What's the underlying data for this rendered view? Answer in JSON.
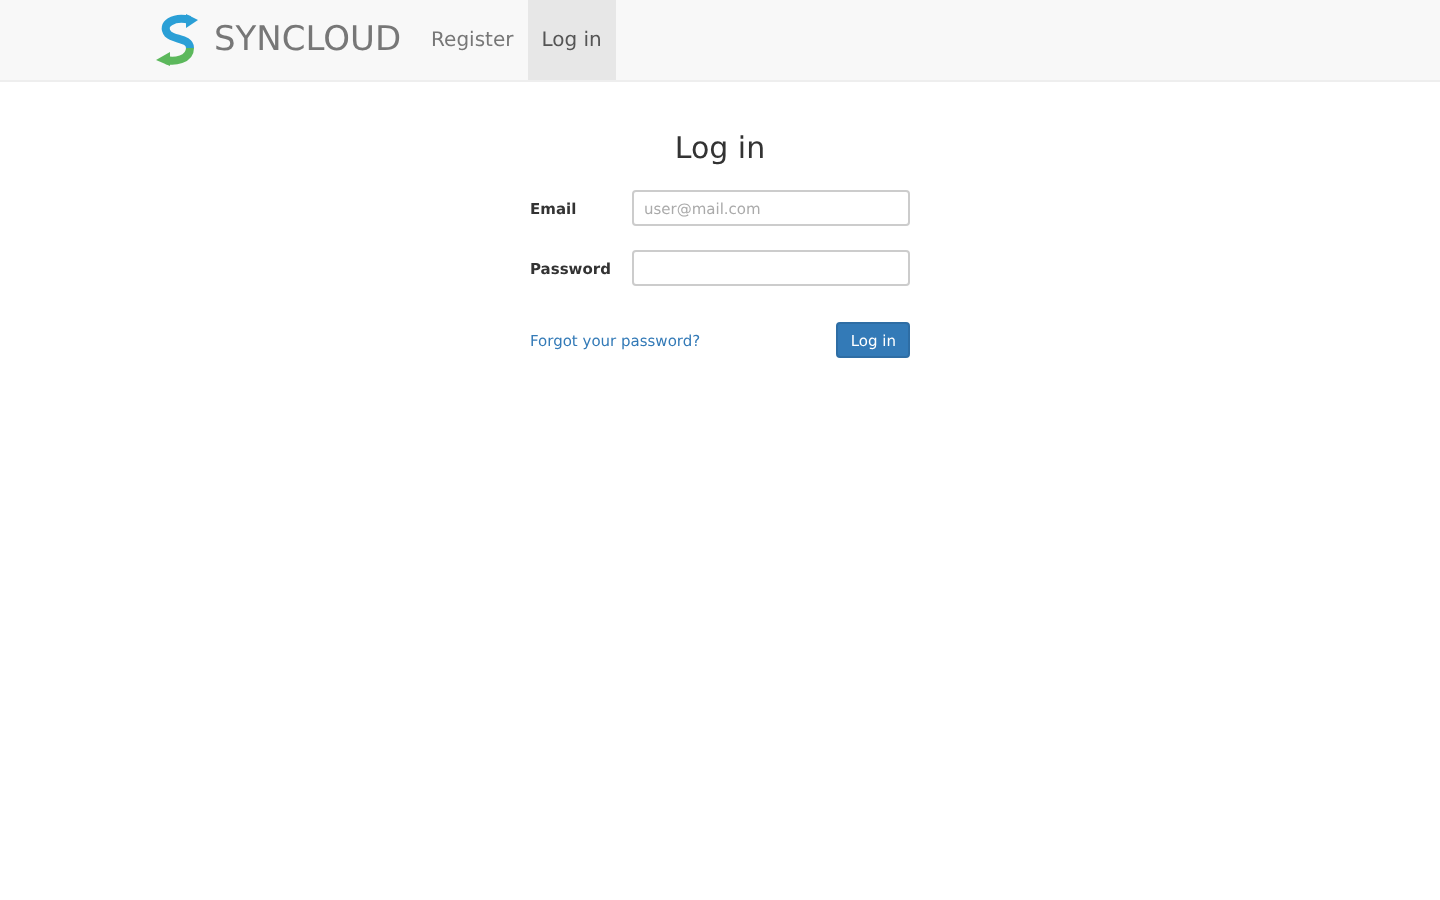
{
  "navbar": {
    "brand": "SYNCLOUD",
    "links": [
      {
        "label": "Register",
        "selected": false
      },
      {
        "label": "Log in",
        "selected": true
      }
    ]
  },
  "form": {
    "title": "Log in",
    "fields": [
      {
        "label": "Email",
        "placeholder": "user@mail.com"
      },
      {
        "label": "Password"
      }
    ],
    "forgot_link": "Forgot your password?",
    "submit": "Log in"
  }
}
